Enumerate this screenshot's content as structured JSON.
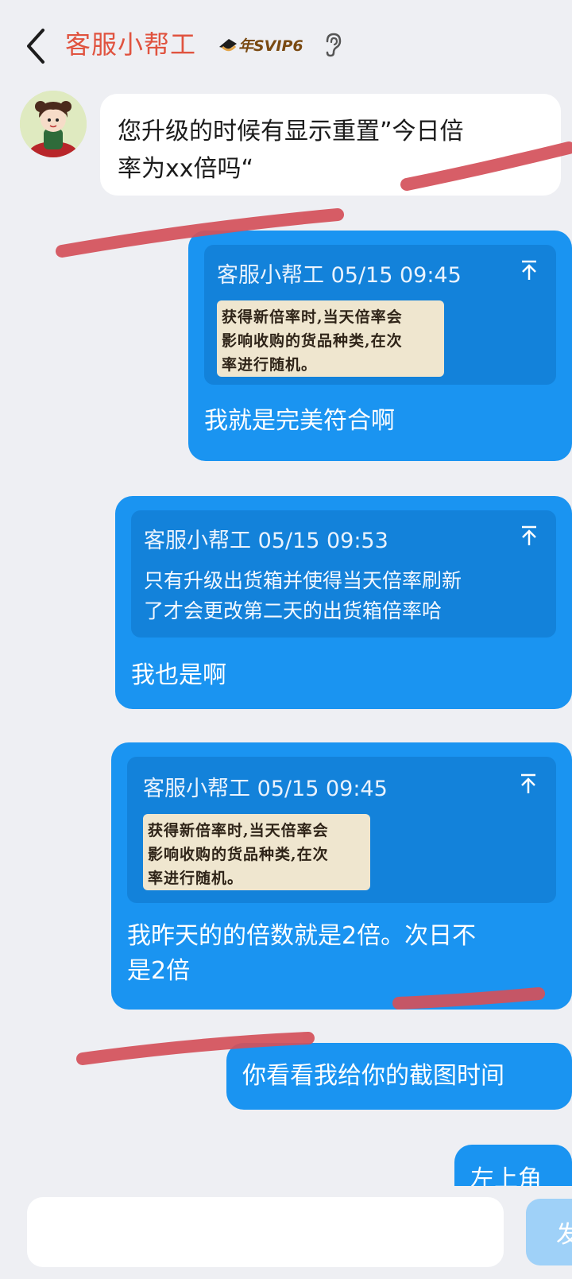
{
  "header": {
    "back_icon": "chevron-left-icon",
    "title": "客服小帮工",
    "vip_badge": "年SVIP6",
    "ear_icon": "ear-icon"
  },
  "messages": [
    {
      "direction": "incoming",
      "text_lines": [
        "您升级的时候有显示重置”今日倍",
        "率为xx倍吗“"
      ]
    },
    {
      "direction": "outgoing",
      "quote": {
        "header": "客服小帮工 05/15 09:45",
        "image_lines": [
          "获得新倍率时,当天倍率会",
          "影响收购的货品种类,在次",
          "率进行随机。"
        ]
      },
      "text": "我就是完美符合啊"
    },
    {
      "direction": "outgoing",
      "quote": {
        "header": "客服小帮工 05/15 09:53",
        "text_lines": [
          "只有升级出货箱并使得当天倍率刷新",
          "了才会更改第二天的出货箱倍率哈"
        ]
      },
      "text": "我也是啊"
    },
    {
      "direction": "outgoing",
      "quote": {
        "header": "客服小帮工 05/15 09:45",
        "image_lines": [
          "获得新倍率时,当天倍率会",
          "影响收购的货品种类,在次",
          "率进行随机。"
        ]
      },
      "text_lines": [
        "我昨天的的倍数就是2倍。次日不",
        "是2倍"
      ]
    },
    {
      "direction": "outgoing",
      "text": "你看看我给你的截图时间"
    },
    {
      "direction": "outgoing",
      "text": "左上角"
    }
  ],
  "input": {
    "value": "",
    "send_label": "发"
  },
  "colors": {
    "bubble_out": "#1a94f1",
    "quote_bg": "#1382da",
    "title": "#e0533f",
    "annotation": "#d4505a"
  }
}
